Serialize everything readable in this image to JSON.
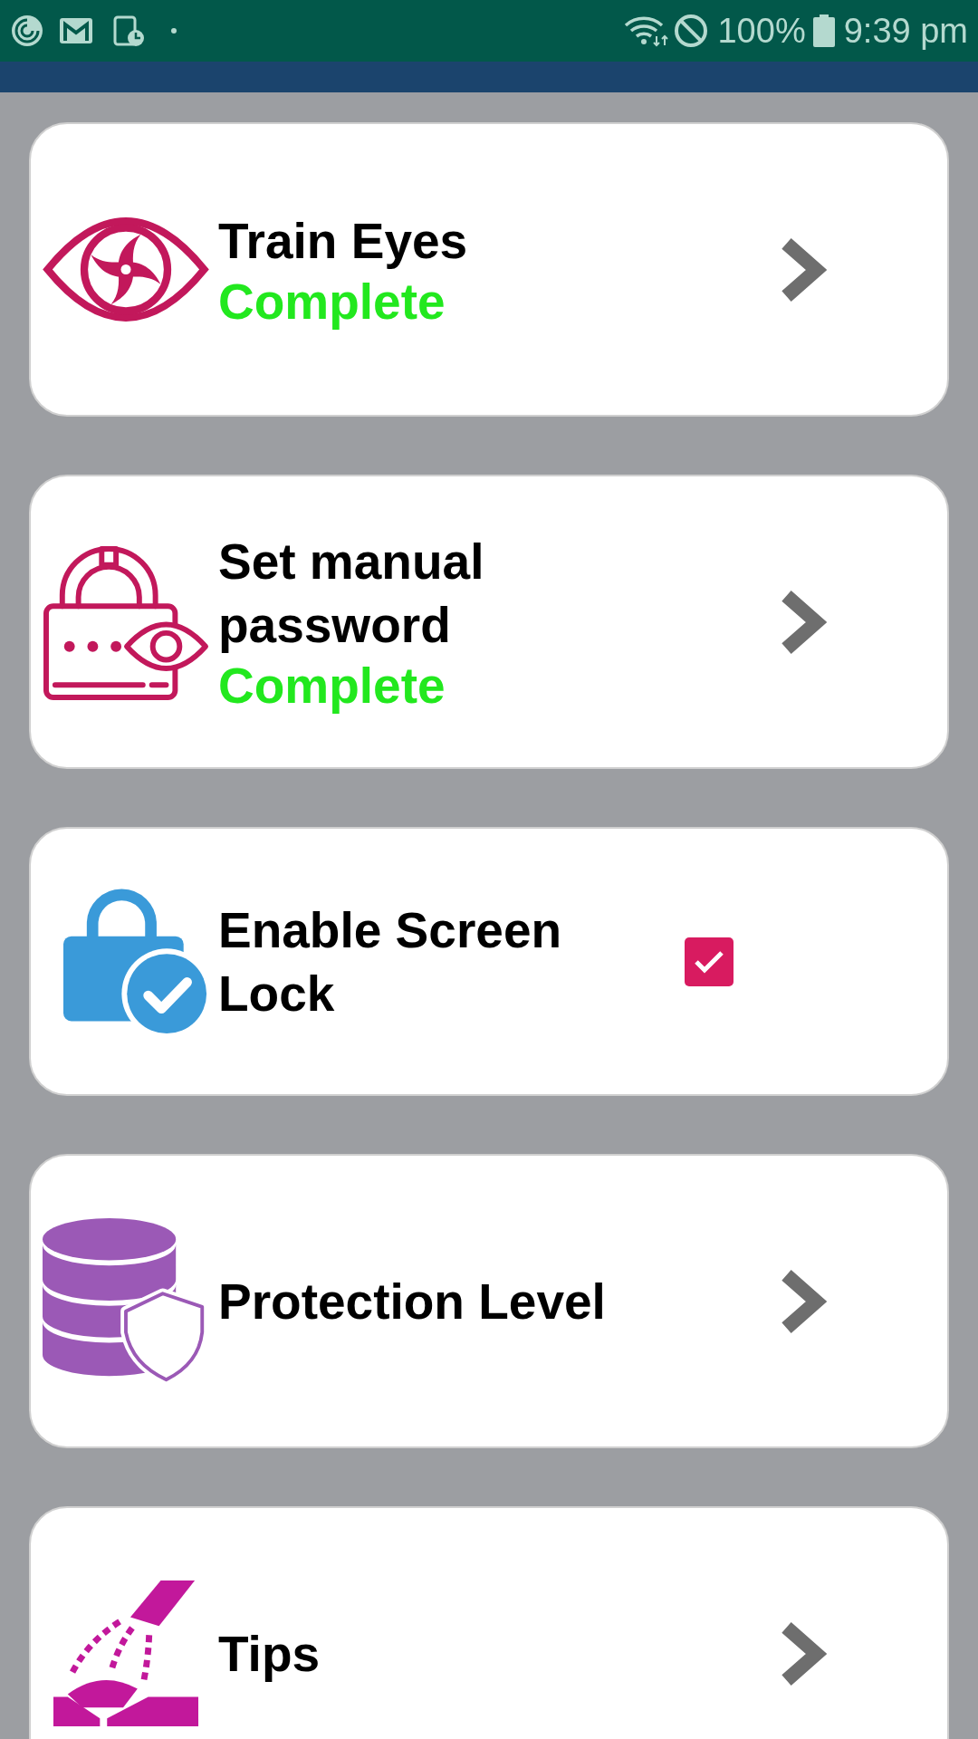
{
  "status_bar": {
    "battery": "100%",
    "time": "9:39 pm"
  },
  "items": [
    {
      "kind": "link",
      "title": "Train Eyes",
      "status": "Complete"
    },
    {
      "kind": "link",
      "title": "Set manual password",
      "status": "Complete"
    },
    {
      "kind": "checkbox",
      "title": "Enable Screen Lock",
      "checked": true
    },
    {
      "kind": "link",
      "title": "Protection Level"
    },
    {
      "kind": "link",
      "title": "Tips"
    }
  ]
}
